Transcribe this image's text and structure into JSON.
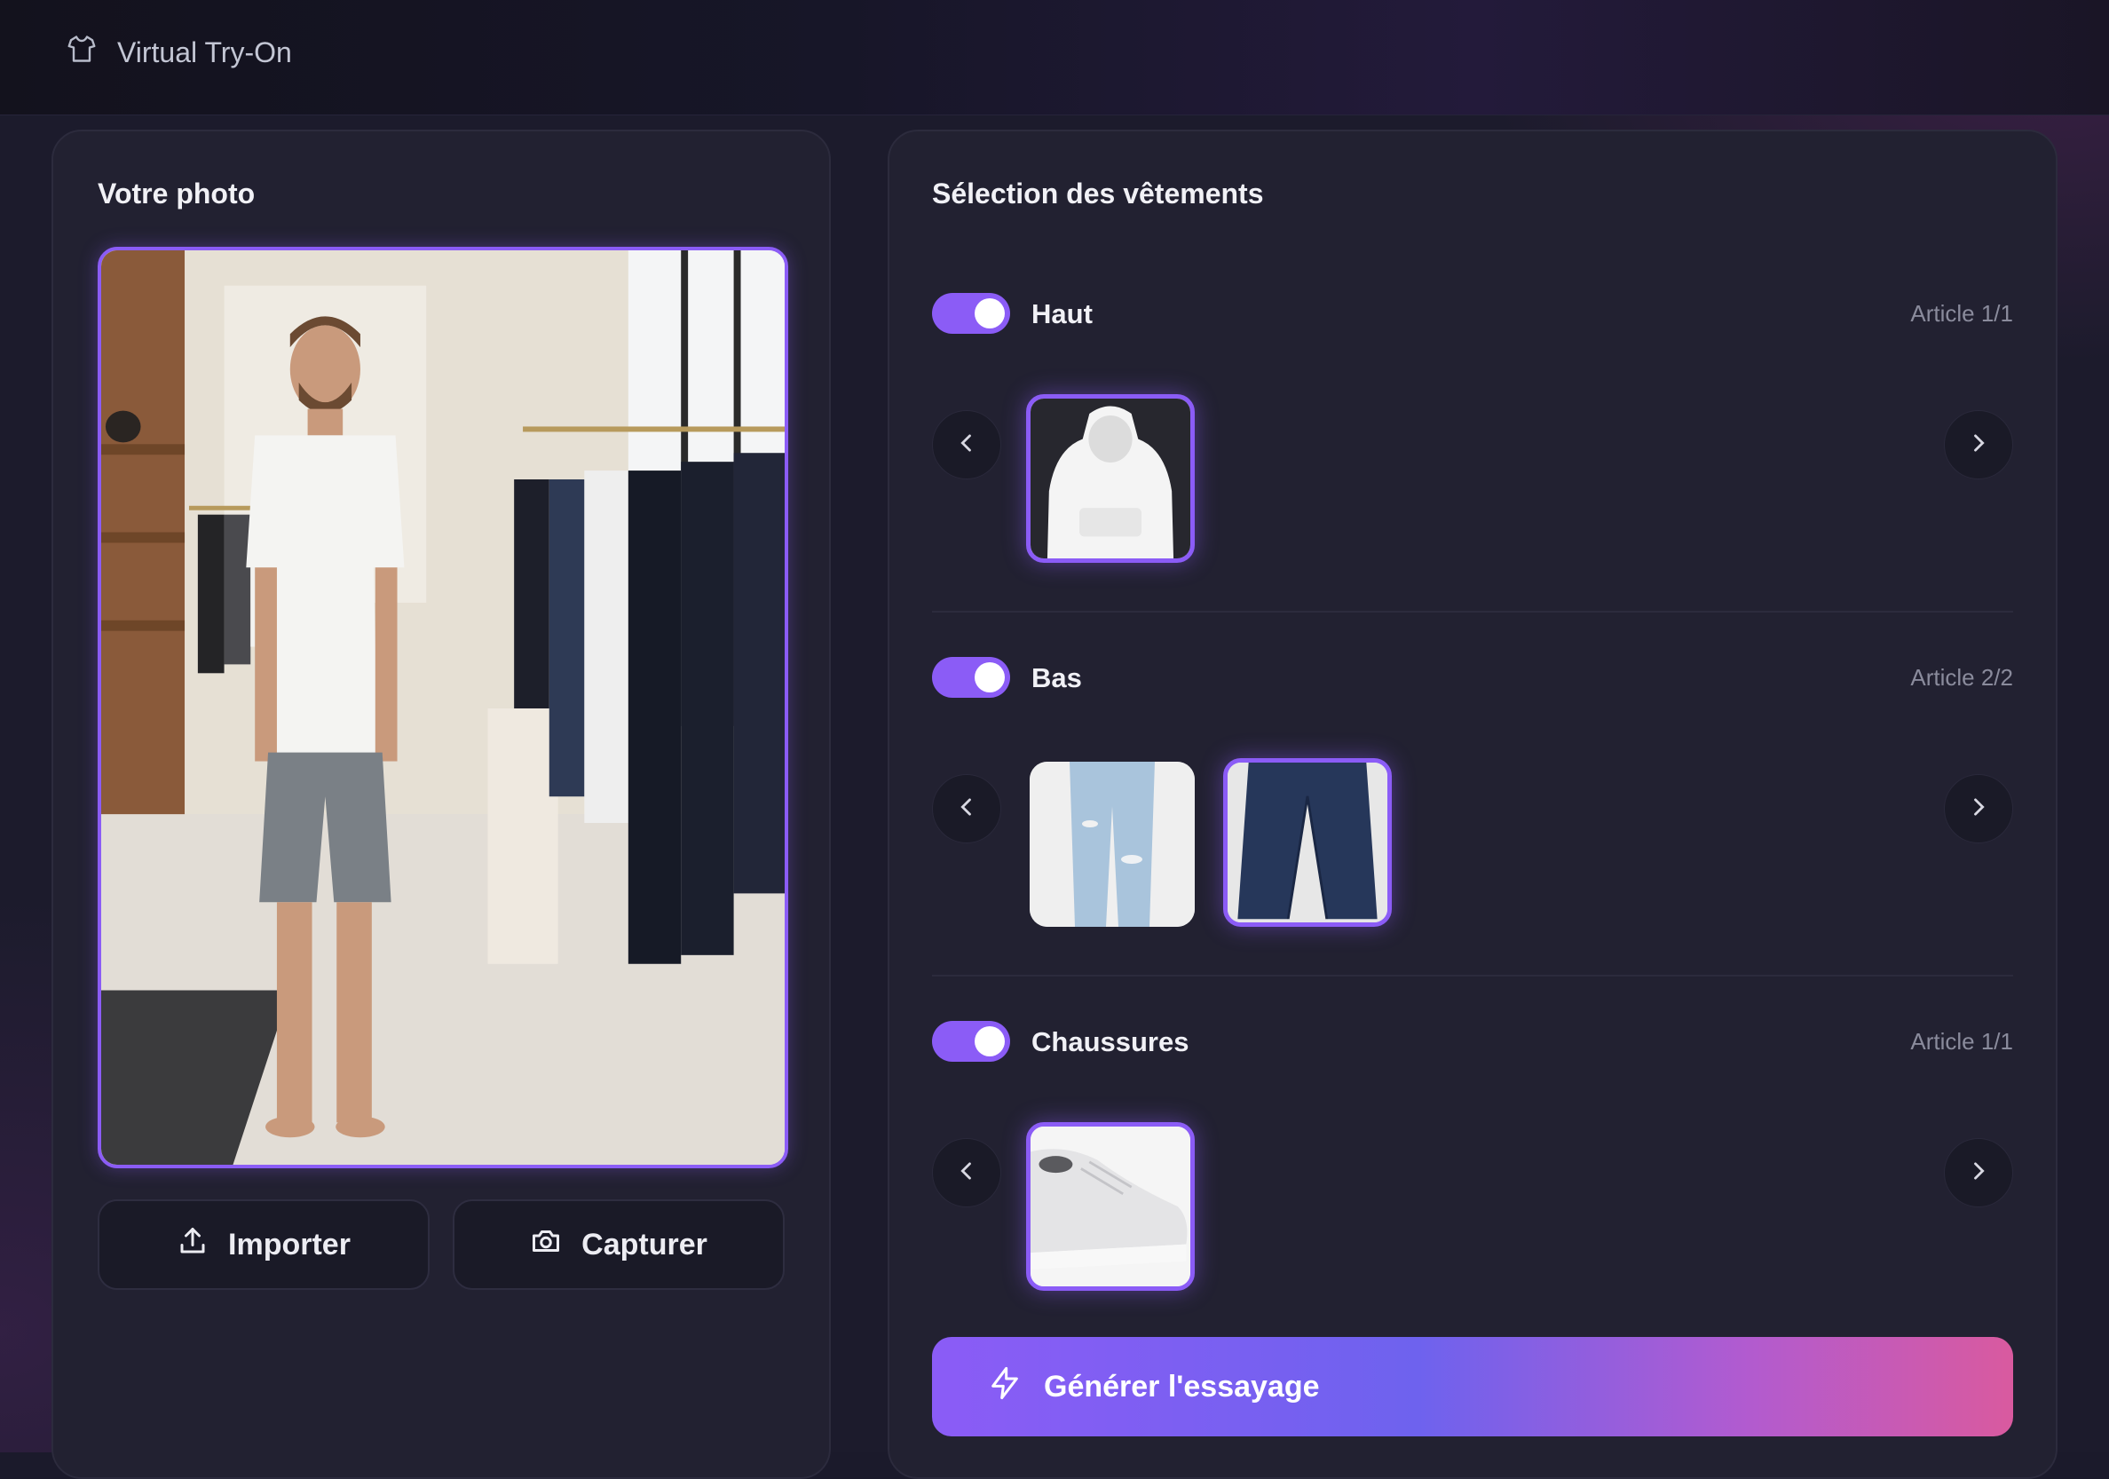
{
  "app": {
    "title": "Virtual Try-On",
    "logo_icon": "shirt-icon"
  },
  "photo_panel": {
    "title": "Votre photo",
    "import_label": "Importer",
    "capture_label": "Capturer"
  },
  "clothing_panel": {
    "title": "Sélection des vêtements",
    "sections": [
      {
        "label": "Haut",
        "counter": "Article 1/1",
        "enabled": true,
        "items": [
          "white-hoodie"
        ],
        "selected": 0
      },
      {
        "label": "Bas",
        "counter": "Article 2/2",
        "enabled": true,
        "items": [
          "light-ripped-jeans",
          "dark-jeans"
        ],
        "selected": 1
      },
      {
        "label": "Chaussures",
        "counter": "Article 1/1",
        "enabled": true,
        "items": [
          "white-sneaker"
        ],
        "selected": 0
      }
    ],
    "generate_label": "Générer l'essayage"
  },
  "colors": {
    "accent": "#8b5cf6",
    "gradient_end": "#d95a9f",
    "panel": "#222131",
    "background": "#1c1b2c"
  }
}
